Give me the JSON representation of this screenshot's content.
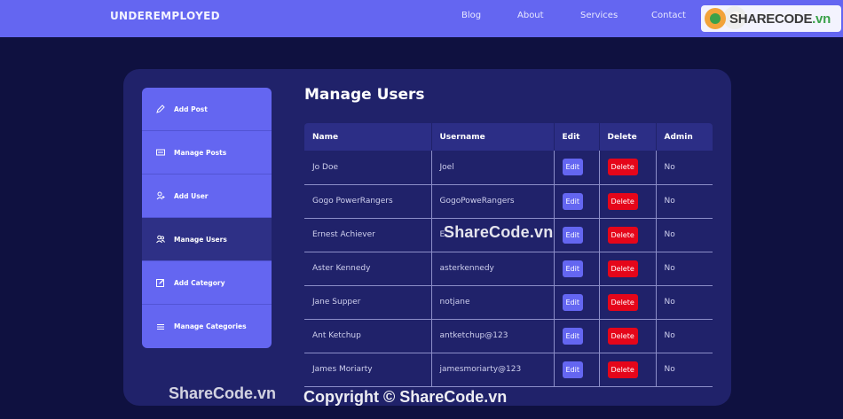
{
  "header": {
    "brand": "UNDEREMPLOYED",
    "nav": [
      "Blog",
      "About",
      "Services",
      "Contact"
    ],
    "logo_text": "SHARECODE.vn"
  },
  "sidebar": {
    "items": [
      {
        "label": "Add Post",
        "icon": "pencil-icon"
      },
      {
        "label": "Manage Posts",
        "icon": "posts-icon"
      },
      {
        "label": "Add User",
        "icon": "add-user-icon"
      },
      {
        "label": "Manage Users",
        "icon": "users-icon",
        "active": true
      },
      {
        "label": "Add Category",
        "icon": "edit-category-icon"
      },
      {
        "label": "Manage Categories",
        "icon": "list-icon"
      }
    ]
  },
  "main": {
    "title": "Manage Users",
    "columns": [
      "Name",
      "Username",
      "Edit",
      "Delete",
      "Admin"
    ],
    "edit_label": "Edit",
    "delete_label": "Delete",
    "rows": [
      {
        "name": "Jo Doe",
        "username": "Joel",
        "admin": "No"
      },
      {
        "name": "Gogo PowerRangers",
        "username": "GogoPoweRangers",
        "admin": "No"
      },
      {
        "name": "Ernest Achiever",
        "username": "E",
        "admin": "No"
      },
      {
        "name": "Aster Kennedy",
        "username": "asterkennedy",
        "admin": "No"
      },
      {
        "name": "Jane Supper",
        "username": "notjane",
        "admin": "No"
      },
      {
        "name": "Ant Ketchup",
        "username": "antketchup@123",
        "admin": "No"
      },
      {
        "name": "James Moriarty",
        "username": "jamesmoriarty@123",
        "admin": "No"
      }
    ]
  },
  "watermarks": {
    "center": "ShareCode.vn",
    "bottom_left": "ShareCode.vn",
    "copyright": "Copyright © ShareCode.vn"
  },
  "colors": {
    "background": "#0f1140",
    "accent": "#6466f1",
    "panel": "#20226a",
    "delete": "#e5061a"
  }
}
